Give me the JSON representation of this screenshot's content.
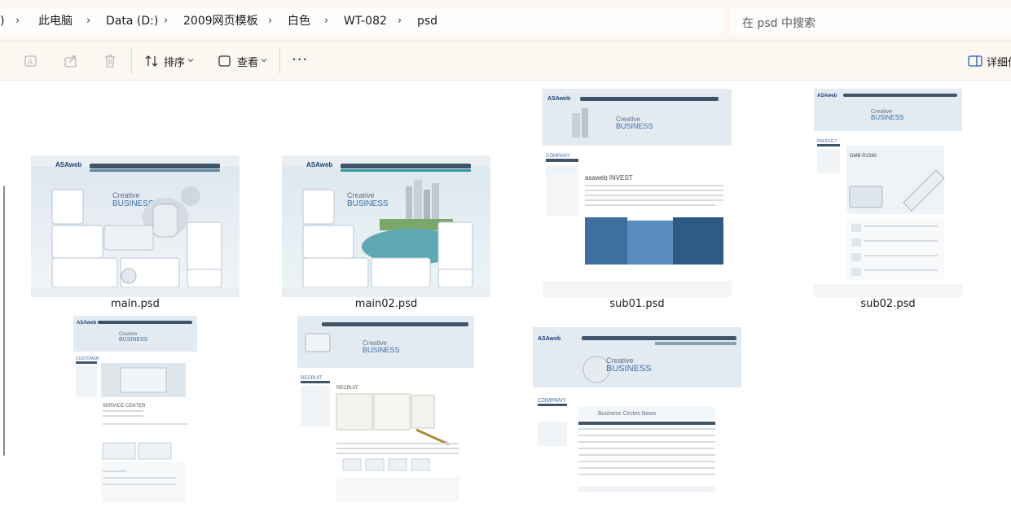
{
  "breadcrumb": {
    "items": [
      "此电脑",
      "Data (D:)",
      "2009网页模板",
      "白色",
      "WT-082",
      "psd"
    ],
    "separator": "›",
    "leading_fragment": ")"
  },
  "search": {
    "placeholder": "在 psd 中搜索"
  },
  "toolbar": {
    "sort_label": "排序",
    "view_label": "查看",
    "more_label": "···",
    "details_label": "详细信"
  },
  "files": [
    {
      "name": "main.psd",
      "brand": "ASAweb",
      "headline_top": "Creative",
      "headline": "BUSINESS",
      "kind": "main"
    },
    {
      "name": "main02.psd",
      "brand": "ASAweb",
      "headline_top": "Creative",
      "headline": "BUSINESS",
      "kind": "main02"
    },
    {
      "name": "sub01.psd",
      "brand": "ASAweb",
      "headline_top": "Creative",
      "headline": "BUSINESS",
      "side_title": "COMPANY",
      "body_title": "asaweb INVEST",
      "kind": "sub01"
    },
    {
      "name": "sub02.psd",
      "brand": "ASAweb",
      "headline_top": "Creative",
      "headline": "BUSINESS",
      "side_title": "PRODUCT",
      "body_title": "DMB-R1560",
      "kind": "sub02"
    },
    {
      "name": "",
      "brand": "ASAweb",
      "headline_top": "Creative",
      "headline": "BUSINESS",
      "side_title": "CUSTOMER",
      "body_title": "SERVICE CENTER",
      "kind": "sub03"
    },
    {
      "name": "",
      "brand": "",
      "headline_top": "Creative",
      "headline": "BUSINESS",
      "side_title": "RECRUIT",
      "body_title": "RECRUIT",
      "kind": "sub04"
    },
    {
      "name": "",
      "brand": "ASAweb",
      "headline_top": "Creative",
      "headline": "BUSINESS",
      "side_title": "COMPANY",
      "body_title": "Business Circles News",
      "kind": "sub05"
    }
  ],
  "colors": {
    "topbar": "#fdf7f2",
    "accent": "#3a7bd5",
    "thumb_nav": "#3f5468"
  }
}
